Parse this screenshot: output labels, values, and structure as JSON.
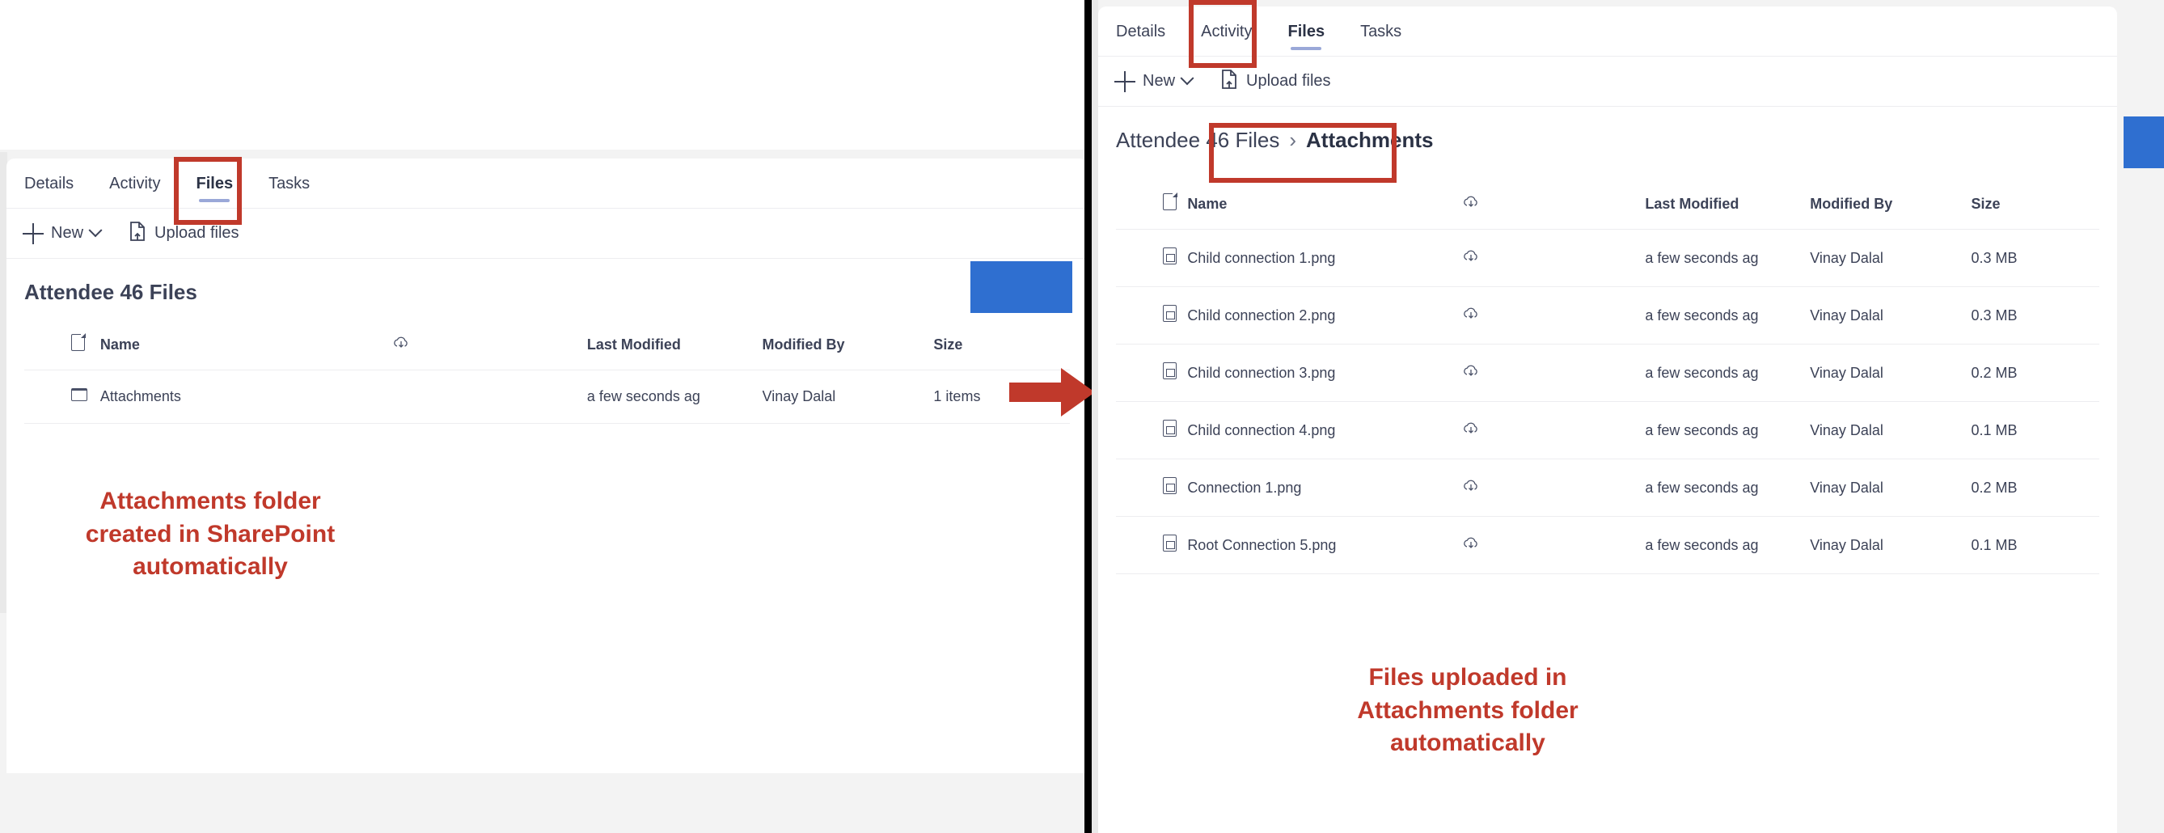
{
  "colors": {
    "annotation_red": "#c0392b",
    "highlight_box": "#c0392b",
    "accent_blue": "#2f6fd0",
    "text": "#3c4257",
    "tab_underline": "#9aa8d8",
    "divider_black": "#000000"
  },
  "left_panel": {
    "tabs": [
      {
        "label": "Details",
        "active": false
      },
      {
        "label": "Activity",
        "active": false
      },
      {
        "label": "Files",
        "active": true
      },
      {
        "label": "Tasks",
        "active": false
      }
    ],
    "toolbar": {
      "new_label": "New",
      "new_icon": "plus-icon",
      "new_chevron_icon": "chevron-down-icon",
      "upload_label": "Upload files",
      "upload_icon": "upload-file-icon"
    },
    "folder_title": "Attendee 46 Files",
    "table": {
      "columns": [
        "",
        "Name",
        "",
        "Last Modified",
        "Modified By",
        "Size"
      ],
      "header_doc_icon": "document-icon",
      "header_cloud_icon": "cloud-download-icon",
      "rows": [
        {
          "icon": "folder-icon",
          "name": "Attachments",
          "cloud_icon": "",
          "last_modified": "a few seconds ag",
          "modified_by": "Vinay Dalal",
          "size": "1 items"
        }
      ]
    },
    "annotation": "Attachments folder\ncreated in SharePoint\nautomatically"
  },
  "right_panel": {
    "tabs": [
      {
        "label": "Details",
        "active": false
      },
      {
        "label": "Activity",
        "active": false
      },
      {
        "label": "Files",
        "active": true
      },
      {
        "label": "Tasks",
        "active": false
      }
    ],
    "toolbar": {
      "new_label": "New",
      "new_icon": "plus-icon",
      "new_chevron_icon": "chevron-down-icon",
      "upload_label": "Upload files",
      "upload_icon": "upload-file-icon"
    },
    "breadcrumb": {
      "parent": "Attendee 46 Files",
      "separator": "›",
      "current": "Attachments"
    },
    "table": {
      "columns": [
        "",
        "Name",
        "",
        "Last Modified",
        "Modified By",
        "Size"
      ],
      "header_doc_icon": "document-icon",
      "header_cloud_icon": "cloud-download-icon",
      "rows": [
        {
          "icon": "image-file-icon",
          "name": "Child connection 1.png",
          "cloud_icon": "cloud-download-icon",
          "last_modified": "a few seconds ag",
          "modified_by": "Vinay Dalal",
          "size": "0.3 MB"
        },
        {
          "icon": "image-file-icon",
          "name": "Child connection 2.png",
          "cloud_icon": "cloud-download-icon",
          "last_modified": "a few seconds ag",
          "modified_by": "Vinay Dalal",
          "size": "0.3 MB"
        },
        {
          "icon": "image-file-icon",
          "name": "Child connection 3.png",
          "cloud_icon": "cloud-download-icon",
          "last_modified": "a few seconds ag",
          "modified_by": "Vinay Dalal",
          "size": "0.2 MB"
        },
        {
          "icon": "image-file-icon",
          "name": "Child connection 4.png",
          "cloud_icon": "cloud-download-icon",
          "last_modified": "a few seconds ag",
          "modified_by": "Vinay Dalal",
          "size": "0.1 MB"
        },
        {
          "icon": "image-file-icon",
          "name": "Connection 1.png",
          "cloud_icon": "cloud-download-icon",
          "last_modified": "a few seconds ag",
          "modified_by": "Vinay Dalal",
          "size": "0.2 MB"
        },
        {
          "icon": "image-file-icon",
          "name": "Root Connection 5.png",
          "cloud_icon": "cloud-download-icon",
          "last_modified": "a few seconds ag",
          "modified_by": "Vinay Dalal",
          "size": "0.1 MB"
        }
      ]
    },
    "annotation": "Files uploaded in\nAttachments folder\nautomatically"
  }
}
